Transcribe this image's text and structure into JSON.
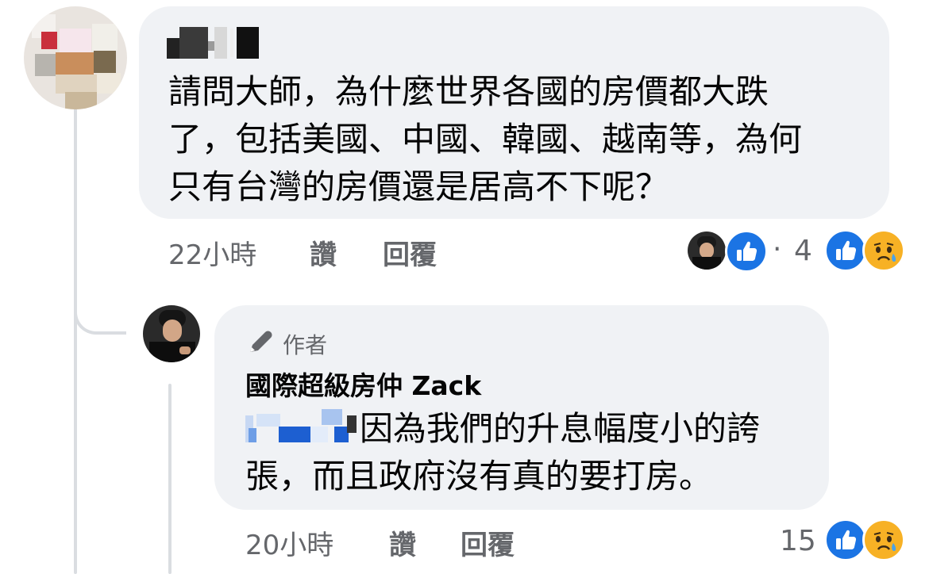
{
  "comment": {
    "author_name": "",
    "text": "請問大師，為什麼世界各國的房價都大跌\n了，包括美國、中國、韓國、越南等，為何\n只有台灣的房價還是居高不下呢？",
    "time": "22小時",
    "like_label": "讚",
    "reply_label": "回覆",
    "reaction_dot": "·",
    "reaction_count": "4"
  },
  "reply": {
    "badge_label": "作者",
    "author_name": "國際超級房仲 Zack",
    "text": "因為我們的升息幅度小的誇\n張，而且政府沒有真的要打房。",
    "time": "20小時",
    "like_label": "讚",
    "reply_label": "回覆",
    "reaction_count": "15"
  },
  "icons": {
    "like": "like-thumb-icon",
    "sad": "sad-face-icon",
    "pen": "pen-icon"
  },
  "colors": {
    "bubble": "#f0f2f5",
    "secondary_text": "#65676b",
    "like_blue": "#1b74e4",
    "sad_yellow": "#f7b125"
  }
}
